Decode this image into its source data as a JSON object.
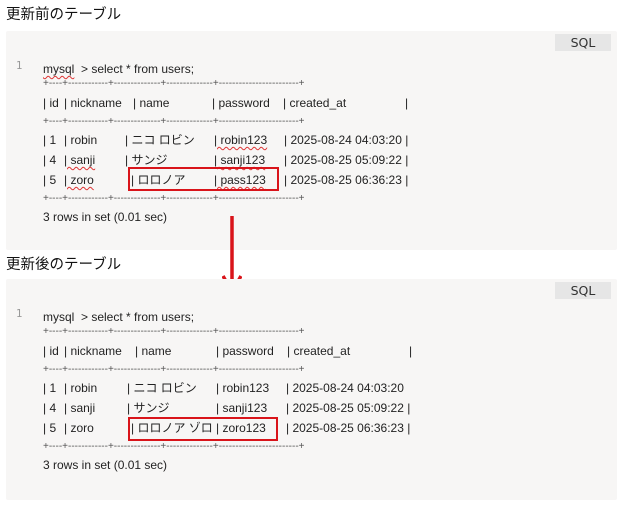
{
  "before": {
    "heading": "更新前のテーブル",
    "lang": "SQL",
    "line_number": "1",
    "prompt": "mysql",
    "command": "> select * from users;",
    "border": "+----+------------+--------------+--------------+------------------------+",
    "header": [
      "| id",
      "| nickname",
      "| name",
      "| password",
      "| created_at",
      "|"
    ],
    "rows": [
      [
        "| 1",
        "| robin",
        "| ニコ ロビン",
        "| robin123",
        "| 2025-08-24 04:03:20 |"
      ],
      [
        "| 4",
        "| sanji",
        "| サンジ",
        "| sanji123",
        "| 2025-08-25 05:09:22 |"
      ],
      [
        "| 5",
        "| zoro",
        "| ロロノア",
        "| pass123",
        "| 2025-08-25 06:36:23 |"
      ]
    ],
    "summary": "3 rows in set (0.01 sec)"
  },
  "after": {
    "heading": "更新後のテーブル",
    "lang": "SQL",
    "line_number": "1",
    "prompt": "mysql",
    "command": "> select * from users;",
    "border": "+----+------------+--------------+--------------+------------------------+",
    "header": [
      "| id",
      "| nickname",
      "| name",
      "| password",
      "| created_at",
      "|"
    ],
    "rows": [
      [
        "| 1",
        "| robin",
        "| ニコ ロビン",
        "| robin123",
        "| 2025-08-24 04:03:20"
      ],
      [
        "| 4",
        "| sanji",
        "| サンジ",
        "| sanji123",
        "| 2025-08-25 05:09:22 |"
      ],
      [
        "| 5",
        "| zoro",
        "| ロロノア ゾロ",
        "| zoro123",
        "| 2025-08-25 06:36:23 |"
      ]
    ],
    "summary": "3 rows in set (0.01 sec)"
  },
  "colors": {
    "highlight": "#d9141a",
    "block_bg": "#f7f6f5",
    "badge_bg": "#e6e6e6"
  },
  "icons": {
    "arrow": "down-arrow-icon"
  }
}
